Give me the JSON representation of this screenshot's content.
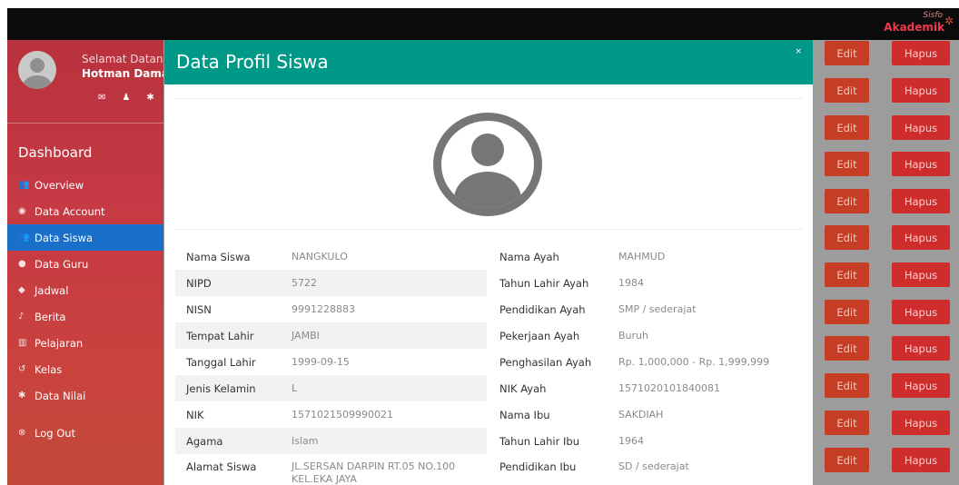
{
  "brand": {
    "line1": "Sisfo",
    "line2": "Akademik"
  },
  "sidebar": {
    "greeting": "Selamat Datan",
    "username": "Hotman Dama",
    "section_title": "Dashboard",
    "items": [
      {
        "label": "Overview",
        "icon": "users-icon"
      },
      {
        "label": "Data Account",
        "icon": "eye-icon"
      },
      {
        "label": "Data Siswa",
        "icon": "users-icon",
        "active": true
      },
      {
        "label": "Data Guru",
        "icon": "circle-icon"
      },
      {
        "label": "Jadwal",
        "icon": "gem-icon"
      },
      {
        "label": "Berita",
        "icon": "bell-icon"
      },
      {
        "label": "Pelajaran",
        "icon": "bank-icon"
      },
      {
        "label": "Kelas",
        "icon": "refresh-icon"
      },
      {
        "label": "Data Nilai",
        "icon": "gear-icon"
      }
    ],
    "logout": "Log Out"
  },
  "modal": {
    "title": "Data Profil Siswa",
    "close": "×",
    "rows": [
      {
        "l1": "Nama Siswa",
        "v1": "NANGKULO",
        "l2": "Nama Ayah",
        "v2": "MAHMUD"
      },
      {
        "l1": "NIPD",
        "v1": "5722",
        "l2": "Tahun Lahir Ayah",
        "v2": "1984"
      },
      {
        "l1": "NISN",
        "v1": "9991228883",
        "l2": "Pendidikan Ayah",
        "v2": "SMP / sederajat"
      },
      {
        "l1": "Tempat Lahir",
        "v1": "JAMBI",
        "l2": "Pekerjaan Ayah",
        "v2": "Buruh"
      },
      {
        "l1": "Tanggal Lahir",
        "v1": "1999-09-15",
        "l2": "Penghasilan Ayah",
        "v2": "Rp. 1,000,000 - Rp. 1,999,999"
      },
      {
        "l1": "Jenis Kelamin",
        "v1": "L",
        "l2": "NIK Ayah",
        "v2": "1571020101840081"
      },
      {
        "l1": "NIK",
        "v1": "1571021509990021",
        "l2": "Nama Ibu",
        "v2": "SAKDIAH"
      },
      {
        "l1": "Agama",
        "v1": "Islam",
        "l2": "Tahun Lahir Ibu",
        "v2": "1964"
      },
      {
        "l1": "Alamat Siswa",
        "v1": "JL.SERSAN DARPIN RT.05 NO.100 KEL.EKA JAYA",
        "l2": "Pendidikan Ibu",
        "v2": "SD / sederajat"
      }
    ]
  },
  "actions": {
    "edit_label": "Edit",
    "delete_label": "Hapus"
  },
  "colors": {
    "header": "#009987",
    "active_nav": "#1a6fc9",
    "edit": "#c63d25",
    "delete": "#cf2c2c"
  }
}
